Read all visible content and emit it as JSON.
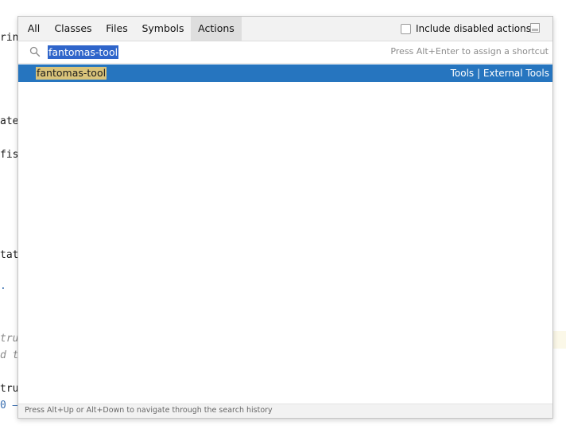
{
  "popup": {
    "tabs": [
      {
        "label": "All"
      },
      {
        "label": "Classes"
      },
      {
        "label": "Files"
      },
      {
        "label": "Symbols"
      },
      {
        "label": "Actions",
        "active": true
      }
    ],
    "include_disabled_label": "Include disabled actions",
    "include_disabled_checked": false,
    "search": {
      "value": "fantomas-tool",
      "hint": "Press Alt+Enter to assign a shortcut",
      "icon": "search-icon"
    },
    "results": [
      {
        "name": "fantomas-tool",
        "path": "Tools | External Tools",
        "selected": true
      }
    ],
    "footer": "Press Alt+Up or Alt+Down to navigate through the search history"
  },
  "editor_background": {
    "fragments": [
      "rin",
      "ate",
      "fis",
      "tat",
      ".",
      "tru",
      "d t",
      "tru",
      "0 —"
    ]
  },
  "colors": {
    "selection": "#2675bf",
    "search_highlight": "#2f65ca",
    "match_highlight": "#d9c37a"
  }
}
